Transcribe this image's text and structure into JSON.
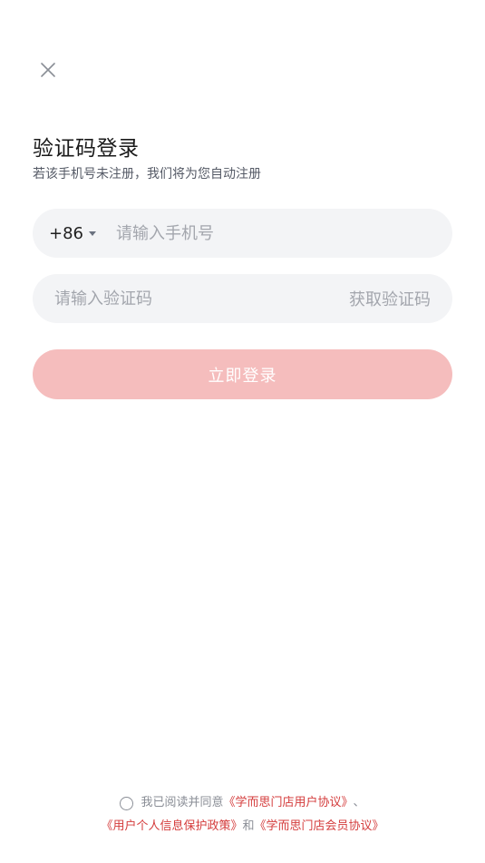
{
  "header": {
    "title": "验证码登录",
    "subtitle": "若该手机号未注册，我们将为您自动注册"
  },
  "phone": {
    "country_code": "+86",
    "placeholder": "请输入手机号",
    "value": ""
  },
  "code": {
    "placeholder": "请输入验证码",
    "value": "",
    "get_code_label": "获取验证码"
  },
  "login_button": {
    "label": "立即登录"
  },
  "agreement": {
    "prefix": "我已阅读并同意",
    "user_agreement": "《学而思门店用户协议》",
    "separator": "、",
    "privacy_policy": "《用户个人信息保护政策》",
    "and": "和",
    "member_agreement": "《学而思门店会员协议》",
    "checked": false
  },
  "colors": {
    "accent": "#f5bdbd",
    "link": "#d43c3c",
    "field_bg": "#f3f4f6"
  }
}
